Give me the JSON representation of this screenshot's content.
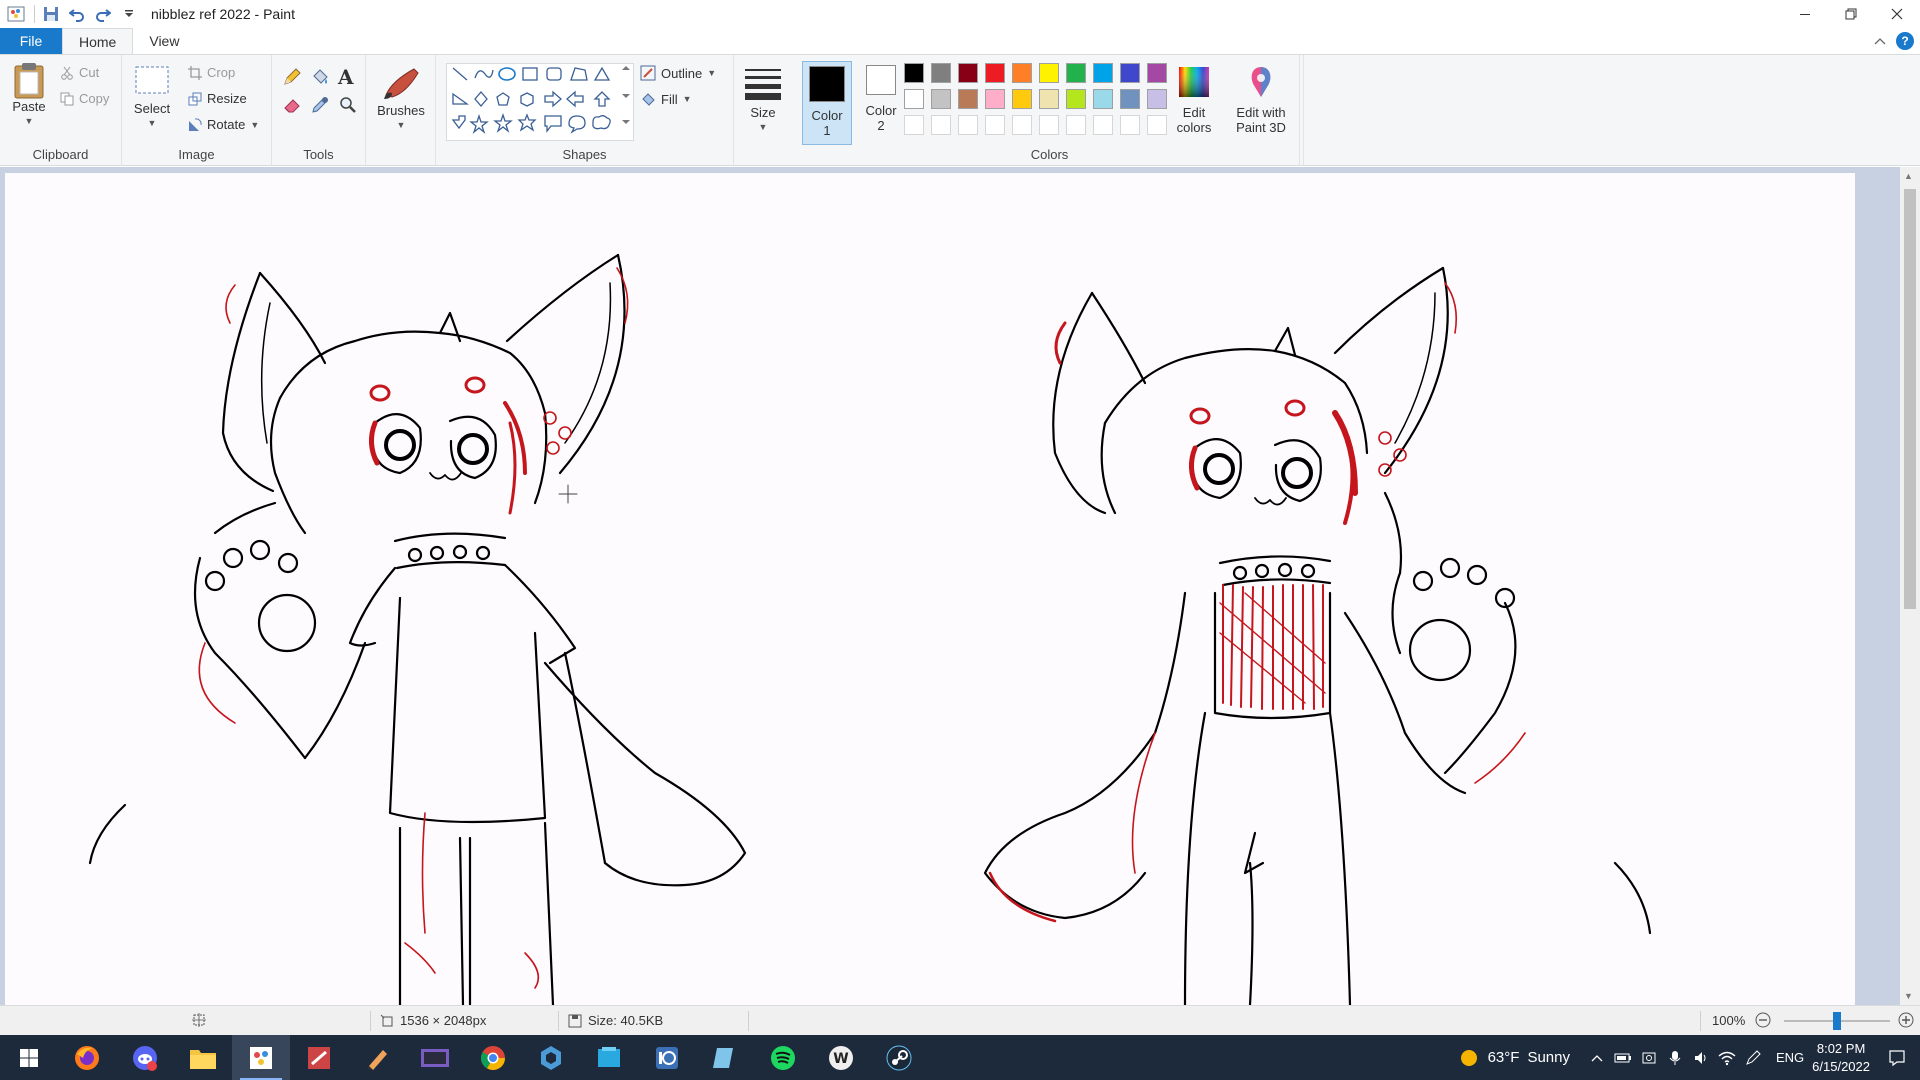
{
  "window": {
    "title": "nibblez ref 2022 - Paint"
  },
  "tabs": {
    "file": "File",
    "home": "Home",
    "view": "View"
  },
  "ribbon": {
    "clipboard": {
      "label": "Clipboard",
      "paste": "Paste",
      "cut": "Cut",
      "copy": "Copy"
    },
    "image": {
      "label": "Image",
      "select": "Select",
      "crop": "Crop",
      "resize": "Resize",
      "rotate": "Rotate"
    },
    "tools": {
      "label": "Tools"
    },
    "brushes": {
      "label": "Brushes"
    },
    "shapes": {
      "label": "Shapes",
      "outline": "Outline",
      "fill": "Fill"
    },
    "size": {
      "label": "Size"
    },
    "colors": {
      "label": "Colors",
      "color1_line1": "Color",
      "color1_line2": "1",
      "color2_line1": "Color",
      "color2_line2": "2",
      "edit_colors_line1": "Edit",
      "edit_colors_line2": "colors",
      "paint3d_line1": "Edit with",
      "paint3d_line2": "Paint 3D",
      "color1_value": "#000000",
      "color2_value": "#ffffff",
      "palette_row1": [
        "#000000",
        "#7f7f7f",
        "#880015",
        "#ed1c24",
        "#ff7f27",
        "#fff200",
        "#22b14c",
        "#00a2e8",
        "#3f48cc",
        "#a349a4"
      ],
      "palette_row2": [
        "#ffffff",
        "#c3c3c3",
        "#b97a57",
        "#ffaec9",
        "#ffc90e",
        "#efe4b0",
        "#b5e61d",
        "#99d9ea",
        "#7092be",
        "#c8bfe7"
      ]
    }
  },
  "status": {
    "dimensions": "1536 × 2048px",
    "size": "Size: 40.5KB",
    "zoom": "100%",
    "zoom_level_percent": 100
  },
  "taskbar": {
    "apps": [
      "start-icon",
      "firefox-icon",
      "discord-icon",
      "file-explorer-icon",
      "paint-icon",
      "app-icon",
      "app-icon",
      "app-icon",
      "chrome-icon",
      "app-icon",
      "app-icon",
      "app-icon",
      "app-icon",
      "spotify-icon",
      "app-icon",
      "steam-icon"
    ],
    "weather_temp": "63°F",
    "weather_text": "Sunny",
    "language": "ENG",
    "time": "8:02 PM",
    "date": "6/15/2022"
  }
}
